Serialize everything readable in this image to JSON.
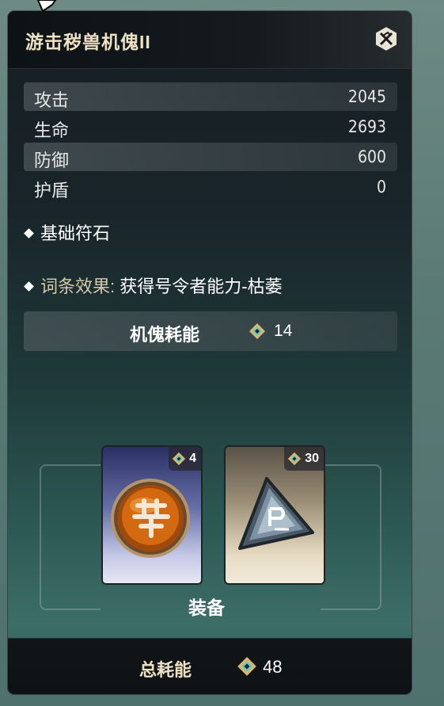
{
  "item": {
    "title": "游击秽兽机傀II"
  },
  "stats": [
    {
      "label": "攻击",
      "value": "2045"
    },
    {
      "label": "生命",
      "value": "2693"
    },
    {
      "label": "防御",
      "value": "600"
    },
    {
      "label": "护盾",
      "value": "0"
    }
  ],
  "rune_type": "基础符石",
  "entry_effect": {
    "prefix": "词条效果:",
    "text": "获得号令者能力-枯萎"
  },
  "puppet_cost": {
    "label": "机傀耗能",
    "value": "14",
    "icon": "energy-diamond-icon"
  },
  "equipment": {
    "label": "装备",
    "cards": [
      {
        "name": "amber-rune-orb",
        "cost": "4",
        "icon": "orb-rune-icon"
      },
      {
        "name": "triangle-stone-rune",
        "cost": "30",
        "icon": "triangle-rune-icon"
      }
    ]
  },
  "footer": {
    "label": "总耗能",
    "value": "48"
  },
  "colors": {
    "accent_gold": "#efe2c4",
    "energy_teal": "#6ec6c0",
    "energy_gold": "#d8b86a"
  }
}
